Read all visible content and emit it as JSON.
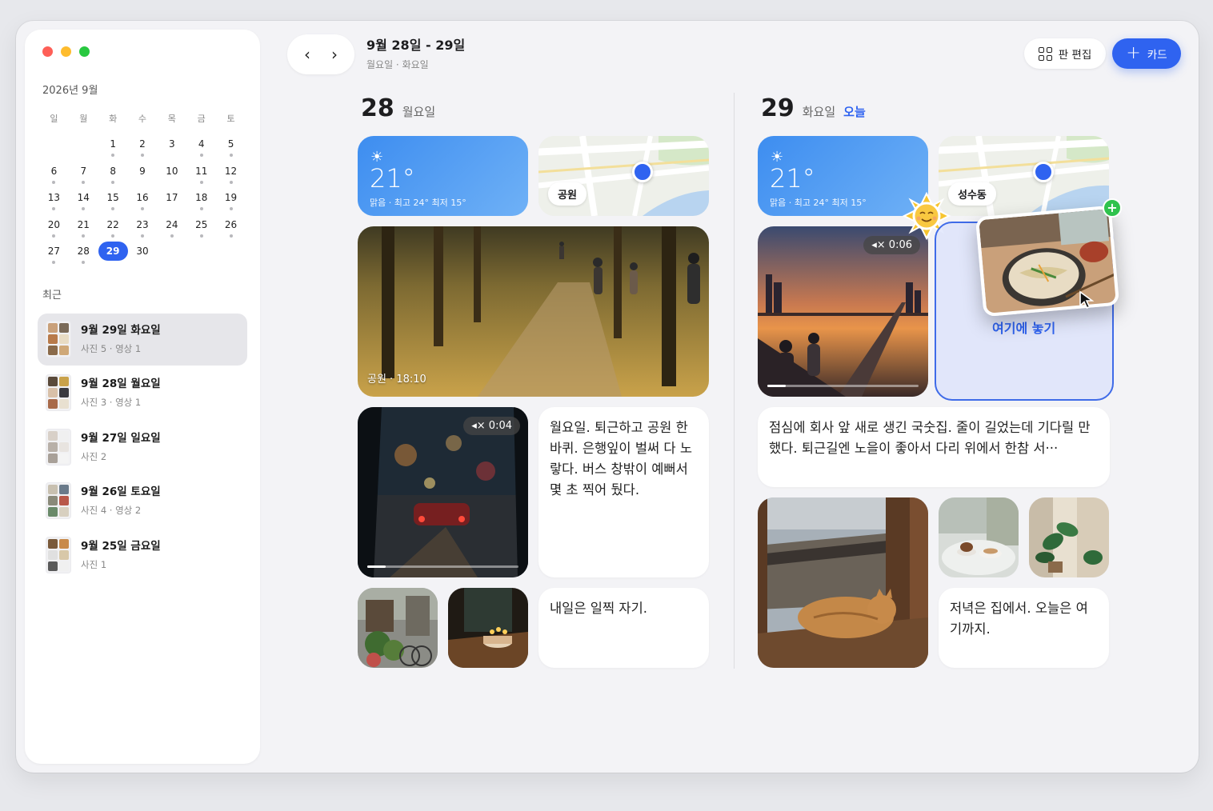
{
  "window": {
    "controls": [
      "close",
      "minimize",
      "zoom"
    ]
  },
  "sidebar": {
    "month_title": "2026년 9월",
    "weekdays": [
      "일",
      "월",
      "화",
      "수",
      "목",
      "금",
      "토"
    ],
    "weeks": [
      [
        null,
        null,
        {
          "d": "1",
          "dot": true
        },
        {
          "d": "2",
          "dot": true
        },
        {
          "d": "3",
          "dot": false
        },
        {
          "d": "4",
          "dot": true
        },
        {
          "d": "5",
          "dot": true
        }
      ],
      [
        {
          "d": "6",
          "dot": true
        },
        {
          "d": "7",
          "dot": true
        },
        {
          "d": "8",
          "dot": true
        },
        {
          "d": "9",
          "dot": false
        },
        {
          "d": "10",
          "dot": false
        },
        {
          "d": "11",
          "dot": true
        },
        {
          "d": "12",
          "dot": true
        }
      ],
      [
        {
          "d": "13",
          "dot": true
        },
        {
          "d": "14",
          "dot": true
        },
        {
          "d": "15",
          "dot": true
        },
        {
          "d": "16",
          "dot": true
        },
        {
          "d": "17",
          "dot": false
        },
        {
          "d": "18",
          "dot": true
        },
        {
          "d": "19",
          "dot": true
        }
      ],
      [
        {
          "d": "20",
          "dot": true
        },
        {
          "d": "21",
          "dot": true
        },
        {
          "d": "22",
          "dot": true
        },
        {
          "d": "23",
          "dot": true
        },
        {
          "d": "24",
          "dot": true
        },
        {
          "d": "25",
          "dot": true
        },
        {
          "d": "26",
          "dot": true
        }
      ],
      [
        {
          "d": "27",
          "dot": true
        },
        {
          "d": "28",
          "dot": true
        },
        {
          "d": "29",
          "dot": false,
          "today": true
        },
        {
          "d": "30",
          "dot": false
        },
        null,
        null,
        null
      ]
    ],
    "recent_label": "최근",
    "recent": [
      {
        "date": "9월 29일 화요일",
        "sub": "사진 5 · 영상 1",
        "active": true
      },
      {
        "date": "9월 28일 월요일",
        "sub": "사진 3 · 영상 1",
        "active": false
      },
      {
        "date": "9월 27일 일요일",
        "sub": "사진 2",
        "active": false
      },
      {
        "date": "9월 26일 토요일",
        "sub": "사진 4 · 영상 2",
        "active": false
      },
      {
        "date": "9월 25일 금요일",
        "sub": "사진 1",
        "active": false
      }
    ]
  },
  "header": {
    "prev_icon": "‹",
    "next_icon": "›",
    "range_title": "9월 28일 - 29일",
    "range_sub": "월요일 · 화요일",
    "edit_label": "판 편집",
    "add_plus": "+",
    "add_label": "카드"
  },
  "day28": {
    "num": "28",
    "weekday": "월요일",
    "weather": {
      "icon": "☀",
      "temp": "21°",
      "desc": "맑음 · 최고 24° 최저 15°"
    },
    "map_label": "공원",
    "photo_caption": "공원 · 18:10",
    "video_duration": "◂× 0:04",
    "video_progress": 0.12,
    "note1": "월요일. 퇴근하고 공원 한 바퀴. 은행잎이 벌써 다 노랗다. 버스 창밖이 예뻐서 몇 초 찍어 뒀다.",
    "note2": "내일은 일찍 자기."
  },
  "day29": {
    "num": "29",
    "weekday": "화요일",
    "today_label": "오늘",
    "weather": {
      "icon": "☀",
      "temp": "21°",
      "desc": "맑음 · 최고 24° 최저 15°"
    },
    "map_label": "성수동",
    "video_duration": "◂× 0:06",
    "video_progress": 0.12,
    "drop_label": "여기에 놓기",
    "drag_plus": "+",
    "note1": "점심에 회사 앞 새로 생긴 국숫집. 줄이 길었는데 기다릴 만했다. 퇴근길엔 노을이 좋아서 다리 위에서 한참 서···",
    "note2": "저녁은 집에서. 오늘은 여기까지."
  },
  "colors": {
    "accent": "#2f63f0",
    "weather_from": "#3d8df0",
    "weather_to": "#6fb1f6",
    "drop_border": "#3f6be8",
    "badge_green": "#2fc24d"
  }
}
